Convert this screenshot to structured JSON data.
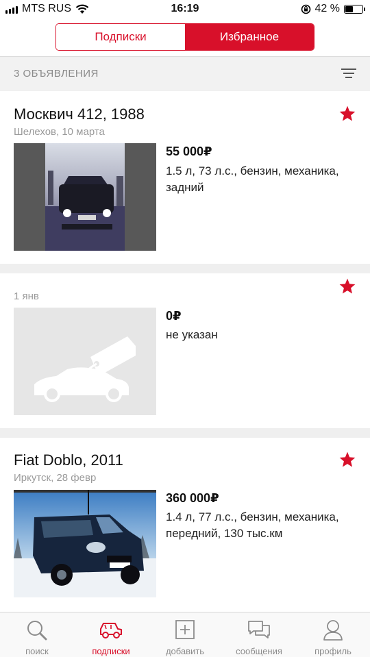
{
  "status_bar": {
    "carrier": "MTS RUS",
    "time": "16:19",
    "battery": "42 %",
    "battery_level": 0.42
  },
  "header": {
    "tabs": [
      {
        "label": "Подписки",
        "active": false
      },
      {
        "label": "Избранное",
        "active": true
      }
    ]
  },
  "list_header": {
    "count_label": "3 ОБЪЯВЛЕНИЯ",
    "sort_icon": "sort-lines-icon"
  },
  "listings": [
    {
      "title": "Москвич 412, 1988",
      "meta": "Шелехов, 10 марта",
      "price": "55 000₽",
      "specs": "1.5 л, 73 л.с., бензин, механика, задний",
      "favorite": true,
      "photo": "car-photo"
    },
    {
      "title": "",
      "meta": "1 янв",
      "price": "0₽",
      "specs": "не указан",
      "favorite": true,
      "photo": "placeholder-car-tag"
    },
    {
      "title": "Fiat Doblo, 2011",
      "meta": "Иркутск, 28 февр",
      "price": "360 000₽",
      "specs": "1.4 л, 77 л.с., бензин, механика, передний, 130 тыс.км",
      "favorite": true,
      "photo": "car-photo"
    }
  ],
  "tab_bar": [
    {
      "label": "поиск",
      "icon": "search-icon",
      "active": false
    },
    {
      "label": "подписки",
      "icon": "car-subscription-icon",
      "active": true
    },
    {
      "label": "добавить",
      "icon": "add-icon",
      "active": false
    },
    {
      "label": "сообщения",
      "icon": "messages-icon",
      "active": false
    },
    {
      "label": "профиль",
      "icon": "profile-icon",
      "active": false
    }
  ],
  "colors": {
    "accent": "#d8102a",
    "muted_text": "#9a9a9a",
    "tab_inactive": "#8c8c8c"
  }
}
